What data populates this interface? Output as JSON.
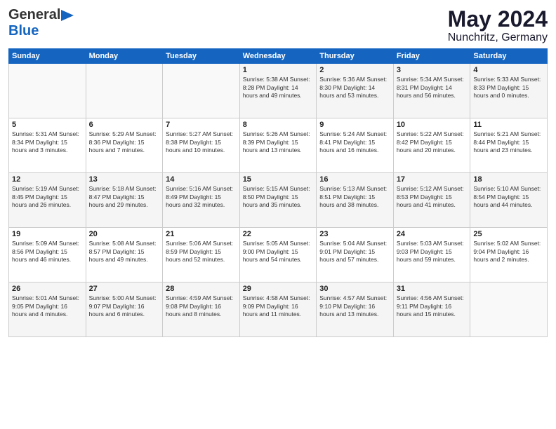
{
  "header": {
    "logo_general": "General",
    "logo_blue": "Blue",
    "month": "May 2024",
    "location": "Nunchritz, Germany"
  },
  "days_of_week": [
    "Sunday",
    "Monday",
    "Tuesday",
    "Wednesday",
    "Thursday",
    "Friday",
    "Saturday"
  ],
  "weeks": [
    [
      {
        "day": "",
        "info": ""
      },
      {
        "day": "",
        "info": ""
      },
      {
        "day": "",
        "info": ""
      },
      {
        "day": "1",
        "info": "Sunrise: 5:38 AM\nSunset: 8:28 PM\nDaylight: 14 hours\nand 49 minutes."
      },
      {
        "day": "2",
        "info": "Sunrise: 5:36 AM\nSunset: 8:30 PM\nDaylight: 14 hours\nand 53 minutes."
      },
      {
        "day": "3",
        "info": "Sunrise: 5:34 AM\nSunset: 8:31 PM\nDaylight: 14 hours\nand 56 minutes."
      },
      {
        "day": "4",
        "info": "Sunrise: 5:33 AM\nSunset: 8:33 PM\nDaylight: 15 hours\nand 0 minutes."
      }
    ],
    [
      {
        "day": "5",
        "info": "Sunrise: 5:31 AM\nSunset: 8:34 PM\nDaylight: 15 hours\nand 3 minutes."
      },
      {
        "day": "6",
        "info": "Sunrise: 5:29 AM\nSunset: 8:36 PM\nDaylight: 15 hours\nand 7 minutes."
      },
      {
        "day": "7",
        "info": "Sunrise: 5:27 AM\nSunset: 8:38 PM\nDaylight: 15 hours\nand 10 minutes."
      },
      {
        "day": "8",
        "info": "Sunrise: 5:26 AM\nSunset: 8:39 PM\nDaylight: 15 hours\nand 13 minutes."
      },
      {
        "day": "9",
        "info": "Sunrise: 5:24 AM\nSunset: 8:41 PM\nDaylight: 15 hours\nand 16 minutes."
      },
      {
        "day": "10",
        "info": "Sunrise: 5:22 AM\nSunset: 8:42 PM\nDaylight: 15 hours\nand 20 minutes."
      },
      {
        "day": "11",
        "info": "Sunrise: 5:21 AM\nSunset: 8:44 PM\nDaylight: 15 hours\nand 23 minutes."
      }
    ],
    [
      {
        "day": "12",
        "info": "Sunrise: 5:19 AM\nSunset: 8:45 PM\nDaylight: 15 hours\nand 26 minutes."
      },
      {
        "day": "13",
        "info": "Sunrise: 5:18 AM\nSunset: 8:47 PM\nDaylight: 15 hours\nand 29 minutes."
      },
      {
        "day": "14",
        "info": "Sunrise: 5:16 AM\nSunset: 8:49 PM\nDaylight: 15 hours\nand 32 minutes."
      },
      {
        "day": "15",
        "info": "Sunrise: 5:15 AM\nSunset: 8:50 PM\nDaylight: 15 hours\nand 35 minutes."
      },
      {
        "day": "16",
        "info": "Sunrise: 5:13 AM\nSunset: 8:51 PM\nDaylight: 15 hours\nand 38 minutes."
      },
      {
        "day": "17",
        "info": "Sunrise: 5:12 AM\nSunset: 8:53 PM\nDaylight: 15 hours\nand 41 minutes."
      },
      {
        "day": "18",
        "info": "Sunrise: 5:10 AM\nSunset: 8:54 PM\nDaylight: 15 hours\nand 44 minutes."
      }
    ],
    [
      {
        "day": "19",
        "info": "Sunrise: 5:09 AM\nSunset: 8:56 PM\nDaylight: 15 hours\nand 46 minutes."
      },
      {
        "day": "20",
        "info": "Sunrise: 5:08 AM\nSunset: 8:57 PM\nDaylight: 15 hours\nand 49 minutes."
      },
      {
        "day": "21",
        "info": "Sunrise: 5:06 AM\nSunset: 8:59 PM\nDaylight: 15 hours\nand 52 minutes."
      },
      {
        "day": "22",
        "info": "Sunrise: 5:05 AM\nSunset: 9:00 PM\nDaylight: 15 hours\nand 54 minutes."
      },
      {
        "day": "23",
        "info": "Sunrise: 5:04 AM\nSunset: 9:01 PM\nDaylight: 15 hours\nand 57 minutes."
      },
      {
        "day": "24",
        "info": "Sunrise: 5:03 AM\nSunset: 9:03 PM\nDaylight: 15 hours\nand 59 minutes."
      },
      {
        "day": "25",
        "info": "Sunrise: 5:02 AM\nSunset: 9:04 PM\nDaylight: 16 hours\nand 2 minutes."
      }
    ],
    [
      {
        "day": "26",
        "info": "Sunrise: 5:01 AM\nSunset: 9:05 PM\nDaylight: 16 hours\nand 4 minutes."
      },
      {
        "day": "27",
        "info": "Sunrise: 5:00 AM\nSunset: 9:07 PM\nDaylight: 16 hours\nand 6 minutes."
      },
      {
        "day": "28",
        "info": "Sunrise: 4:59 AM\nSunset: 9:08 PM\nDaylight: 16 hours\nand 8 minutes."
      },
      {
        "day": "29",
        "info": "Sunrise: 4:58 AM\nSunset: 9:09 PM\nDaylight: 16 hours\nand 11 minutes."
      },
      {
        "day": "30",
        "info": "Sunrise: 4:57 AM\nSunset: 9:10 PM\nDaylight: 16 hours\nand 13 minutes."
      },
      {
        "day": "31",
        "info": "Sunrise: 4:56 AM\nSunset: 9:11 PM\nDaylight: 16 hours\nand 15 minutes."
      },
      {
        "day": "",
        "info": ""
      }
    ]
  ]
}
